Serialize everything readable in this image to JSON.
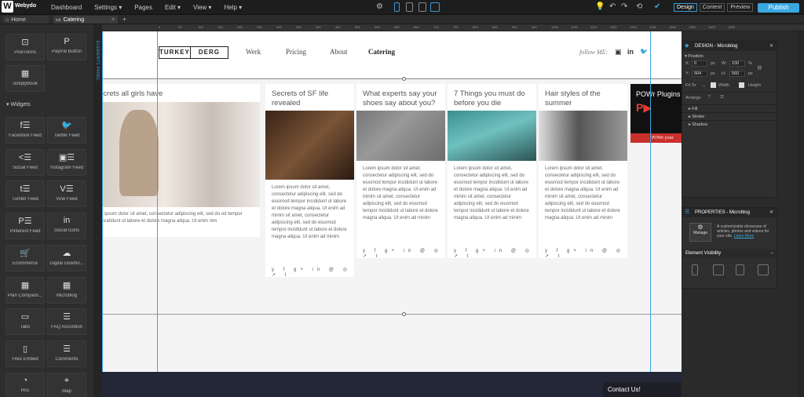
{
  "app": {
    "logo_letter": "W",
    "logo_text": "Webydo"
  },
  "menu": [
    "Dashboard",
    "Settings ▾",
    "Pages",
    "Edit ▾",
    "View ▾",
    "Help ▾"
  ],
  "modes": [
    "Design",
    "Content",
    "Preview"
  ],
  "publish_label": "Publish",
  "tabs": [
    {
      "label": "Home"
    },
    {
      "label": "Catering"
    }
  ],
  "sidebar": {
    "top_items": [
      {
        "label": "PowToons",
        "icon": "camera-icon"
      },
      {
        "label": "PayPal Button",
        "icon": "paypal-icon"
      },
      {
        "label": "SimplyBook",
        "icon": "keyboard-icon"
      }
    ],
    "widgets_header": "▾ Widgets",
    "widgets": [
      {
        "label": "Facebook Feed",
        "icon": "facebook-icon"
      },
      {
        "label": "Twitter Feed",
        "icon": "twitter-icon"
      },
      {
        "label": "Social Feed",
        "icon": "share-icon"
      },
      {
        "label": "Instagram Feed",
        "icon": "instagram-icon"
      },
      {
        "label": "Tumblr Feed",
        "icon": "tumblr-icon"
      },
      {
        "label": "Vine Feed",
        "icon": "vine-icon"
      },
      {
        "label": "Pinterest Feed",
        "icon": "pinterest-icon"
      },
      {
        "label": "Social Icons",
        "icon": "social-icon"
      },
      {
        "label": "Ecommerce",
        "icon": "cart-icon"
      },
      {
        "label": "Digital Downlo...",
        "icon": "cloud-download-icon"
      },
      {
        "label": "Plan Comparis...",
        "icon": "table-icon"
      },
      {
        "label": "Microblog",
        "icon": "grid-icon"
      },
      {
        "label": "Tabs",
        "icon": "tabs-icon"
      },
      {
        "label": "FAQ Accordion",
        "icon": "accordion-icon"
      },
      {
        "label": "Files Embed",
        "icon": "file-icon"
      },
      {
        "label": "Comments",
        "icon": "comments-icon"
      },
      {
        "label": "Rss",
        "icon": "rss-icon"
      },
      {
        "label": "Map",
        "icon": "map-pin-icon"
      }
    ]
  },
  "elements_panel_label": "ELEMENTS PANEL",
  "ruler_ticks": [
    "0",
    "50",
    "100",
    "150",
    "200",
    "250",
    "300",
    "350",
    "400",
    "450",
    "500",
    "550",
    "600",
    "650",
    "700",
    "750",
    "800",
    "850",
    "900",
    "950",
    "1000",
    "1050",
    "1100",
    "1150",
    "1200",
    "1250",
    "1300",
    "1350",
    "1400",
    "1450"
  ],
  "site": {
    "brand_a": "TURKEY",
    "brand_b": "DERG",
    "nav": [
      "Werk",
      "Pricing",
      "About",
      "Catering"
    ],
    "follow": "follow ME:",
    "social": [
      "▣",
      "in",
      "🐦"
    ]
  },
  "posts": [
    {
      "title": "ecrets all girls have",
      "text": "n ipsum dolor sit amet, consectetur adipiscing elit, sed do od tempor incididunt ut labore et dolore magna aliqua. Ut enim nim"
    },
    {
      "title": "Secrets of SF life revealed",
      "text": "Lorem ipsum dolor sit amet, consectetur adipiscing elit, sed do eiusmod tempor incididunt ut labore et dolore magna aliqua. Ut enim ad minim sit amet, consectetur adipiscing elit, sed do eiusmod tempor incididunt ut labore et dolore magna aliqua. Ut enim ad minim"
    },
    {
      "title": "What experts say your shoes say about you?",
      "text": "Lorem ipsum dolor sit amet, consectetur adipiscing elit, sed do eiusmod tempor incididunt ut labore et dolore magna aliqua. Ut enim ad minim sit amet, consectetur adipiscing elit, sed do eiusmod tempor incididunt ut labore et dolore magna aliqua. Ut enim ad minim"
    },
    {
      "title": "7 Things you must do before you die",
      "text": "Lorem ipsum dolor sit amet, consectetur adipiscing elit, sed do eiusmod tempor incididunt ut labore et dolore magna aliqua. Ut enim ad minim sit amet, consectetur adipiscing elit, sed do eiusmod tempor incididunt ut labore et dolore magna aliqua. Ut enim ad minim"
    },
    {
      "title": "Hair styles of the summer",
      "text": "Lorem ipsum dolor sit amet, consectetur adipiscing elit, sed do eiusmod tempor incididunt ut labore et dolore magna aliqua. Ut enim ad minim sit amet, consectetur adipiscing elit, sed do eiusmod tempor incididunt ut labore et dolore magna aliqua. Ut enim ad minim"
    }
  ],
  "share_icons": "y f g+ in @ ◎ ↗ t",
  "powr": {
    "title": "POWr Plugins",
    "logo": "P▶",
    "bar": "POWr your"
  },
  "contact": {
    "label": "Contact Us!",
    "chev": "^"
  },
  "design_panel": {
    "title": "DESIGN - Microblog",
    "position": "▾ Position",
    "x_label": "X:",
    "x": "0",
    "w_label": "W:",
    "w": "100",
    "w_unit": "%",
    "y_label": "Y:",
    "y": "504",
    "h_label": "H:",
    "h": "560",
    "unit": "px",
    "fit_to": "Fit To",
    "width": "Width",
    "height": "Height",
    "arrange": "Arrange",
    "sections": [
      "▸ Fill",
      "▸ Stroke",
      "▸ Shadow"
    ]
  },
  "properties_panel": {
    "title": "PROPERTIES - Microblog",
    "manage": "Manage",
    "desc": "A customizable showcase of articles, photos and videos for your site.",
    "learn_more": "Learn More",
    "visibility": "Element Visibility"
  },
  "colors": {
    "accent": "#3aa8e0",
    "footer": "#242737"
  }
}
